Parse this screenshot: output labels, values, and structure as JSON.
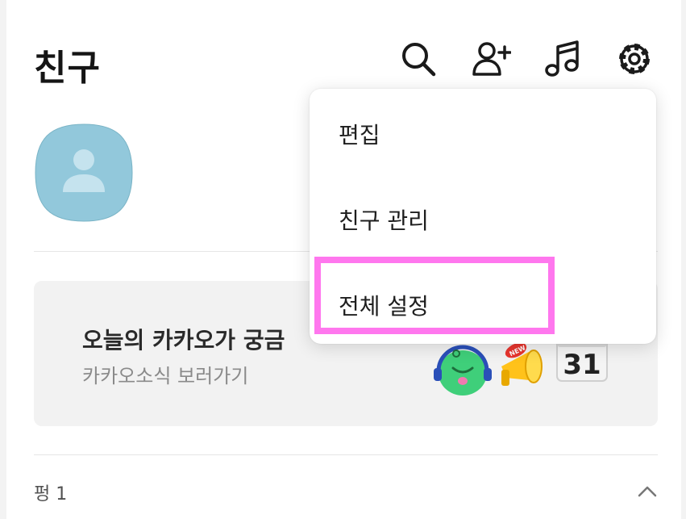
{
  "header": {
    "title": "친구",
    "icons": [
      "search-icon",
      "add-friend-icon",
      "music-icon",
      "settings-icon"
    ]
  },
  "profile": {
    "avatar": "default-profile-avatar"
  },
  "banner": {
    "title": "오늘의 카카오가 궁금",
    "subtitle": "카카오소식 보러가기",
    "calendar_day": "31",
    "badge": "NEW"
  },
  "section": {
    "label": "펑 1"
  },
  "menu": {
    "items": [
      {
        "label": "편집"
      },
      {
        "label": "친구 관리"
      },
      {
        "label": "전체 설정",
        "highlighted": true
      }
    ]
  },
  "colors": {
    "avatar_bg": "#92C8DB",
    "highlight": "#FF77EE",
    "banner_bg": "#F2F2F2"
  }
}
